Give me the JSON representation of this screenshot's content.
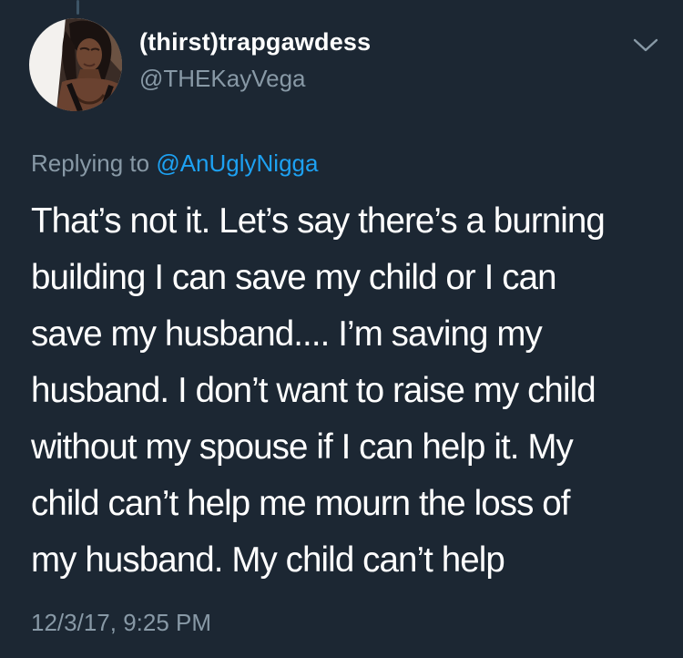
{
  "tweet": {
    "display_name": "(thirst)trapgawdess",
    "handle": "@THEKayVega",
    "replying_prefix": "Replying to ",
    "replying_to": "@AnUglyNigga",
    "text_lines": [
      "That’s not it. Let’s say there’s a burning",
      "building I can save my child or I can",
      "save my husband.... I’m saving my",
      "husband. I don’t want to raise my child",
      "without my spouse if I can help it. My",
      "child can’t help me mourn the loss of",
      "my husband. My child can’t help"
    ],
    "timestamp": "12/3/17, 9:25 PM"
  },
  "icons": {
    "menu": "chevron-down-icon",
    "avatar": "profile-photo"
  },
  "colors": {
    "background": "#1c2733",
    "primary_text": "#ffffff",
    "secondary_text": "#8899a6",
    "link": "#1da1f2",
    "thread_line": "#3d5466"
  }
}
